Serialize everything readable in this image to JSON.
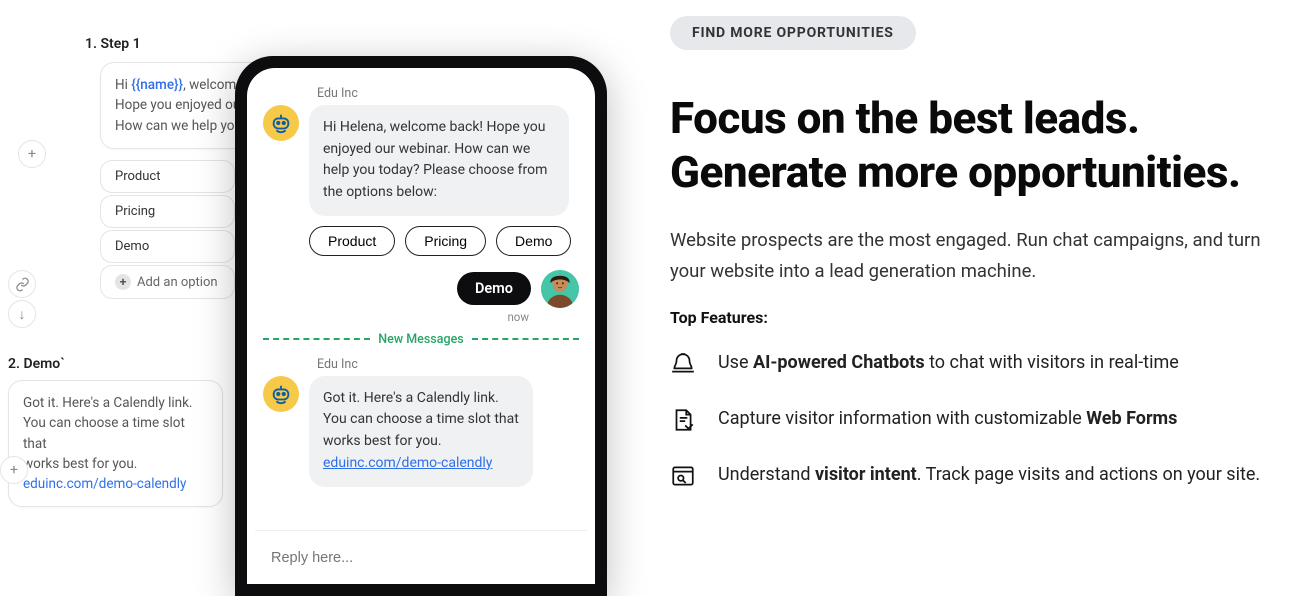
{
  "flow": {
    "step1_label": "1. Step 1",
    "step1_text_pre": "Hi ",
    "step1_text_tag": "{{name}}",
    "step1_text_post": ", welcome b",
    "step1_text_l2": "Hope you enjoyed our w",
    "step1_text_l3": "How can we help you...",
    "options": {
      "product": "Product",
      "pricing": "Pricing",
      "demo": "Demo",
      "add": "Add an option"
    },
    "step2_label": "2. Demo`",
    "step2_l1": "Got it. Here's a Calendly link.",
    "step2_l2": "You can choose a time slot that",
    "step2_l3": "works best for you.",
    "step2_link": "eduinc.com/demo-calendly"
  },
  "chat": {
    "sender": "Edu Inc",
    "bot_msg1": "Hi Helena, welcome back! Hope you enjoyed our webinar. How can we help you today? Please choose from the options below:",
    "chips": {
      "product": "Product",
      "pricing": "Pricing",
      "demo": "Demo"
    },
    "user_reply": "Demo",
    "now": "now",
    "divider": "New Messages",
    "bot_msg2_l1": "Got it. Here's a Calendly link.",
    "bot_msg2_l2": "You can choose a time slot that",
    "bot_msg2_l3": "works best for you.",
    "bot_msg2_link": "eduinc.com/demo-calendly",
    "reply_placeholder": "Reply here..."
  },
  "marketing": {
    "badge": "FIND MORE OPPORTUNITIES",
    "headline_l1": "Focus on the best leads.",
    "headline_l2": "Generate more opportunities.",
    "subtext": "Website prospects are the most engaged. Run chat campaigns, and turn your website into a lead generation machine.",
    "top_features": "Top Features:",
    "f1_pre": "Use ",
    "f1_bold": "AI-powered Chatbots",
    "f1_post": " to chat with visitors in real-time",
    "f2_pre": " Capture visitor information with customizable ",
    "f2_bold": "Web Forms",
    "f3_pre": "Understand ",
    "f3_bold": "visitor intent",
    "f3_post": ". Track page visits and actions on your site."
  }
}
